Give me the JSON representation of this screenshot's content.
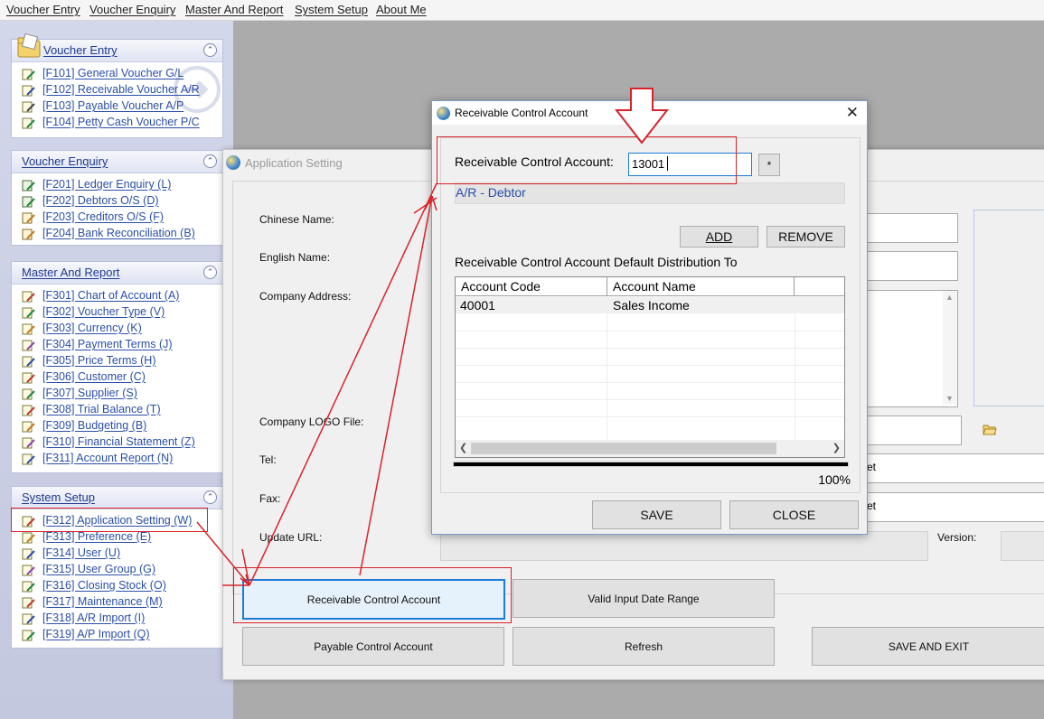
{
  "menubar": {
    "items": [
      "Voucher Entry",
      "Voucher Enquiry",
      "Master And Report",
      "System Setup",
      "About Me"
    ]
  },
  "sidebar": {
    "voucher_entry": {
      "title": "Voucher Entry",
      "items": [
        "[F101] General Voucher G/L",
        "[F102] Receivable Voucher A/R",
        "[F103] Payable Voucher A/P",
        "[F104] Petty Cash Voucher P/C"
      ]
    },
    "voucher_enquiry": {
      "title": "Voucher Enquiry",
      "items": [
        "[F201] Ledger Enquiry (L)",
        "[F202] Debtors O/S (D)",
        "[F203] Creditors O/S (F)",
        "[F204] Bank Reconciliation (B)"
      ]
    },
    "master_report": {
      "title": "Master And Report",
      "items": [
        "[F301] Chart of Account (A)",
        "[F302] Voucher Type (V)",
        "[F303] Currency (K)",
        "[F304] Payment Terms (J)",
        "[F305] Price Terms (H)",
        "[F306] Customer (C)",
        "[F307] Supplier (S)",
        "[F308] Trial Balance (T)",
        "[F309] Budgeting (B)",
        "[F310] Financial Statement (Z)",
        "[F311] Account Report (N)"
      ]
    },
    "system_setup": {
      "title": "System Setup",
      "items": [
        "[F312] Application Setting (W)",
        "[F313] Preference (E)",
        "[F314] User (U)",
        "[F315] User Group (G)",
        "[F316] Closing Stock (O)",
        "[F317] Maintenance (M)",
        "[F318] A/R Import (I)",
        "[F319] A/P Import (Q)"
      ]
    }
  },
  "app_setting": {
    "title": "Application Setting",
    "labels": {
      "chinese_name": "Chinese Name:",
      "english_name": "English Name:",
      "company_address": "Company Address:",
      "logo_file": "Company LOGO File:",
      "tel": "Tel:",
      "fax": "Fax:",
      "update_url": "Update URL:",
      "version": "Version:"
    },
    "tel_partial": "et",
    "fax_partial": "et",
    "buttons": {
      "receivable_control": "Receivable Control Account",
      "valid_date_range": "Valid Input Date Range",
      "payable_control": "Payable Control Account",
      "refresh": "Refresh",
      "save_exit": "SAVE AND EXIT"
    }
  },
  "dialog": {
    "title": "Receivable Control Account",
    "account_label": "Receivable Control Account:",
    "account_value": "13001",
    "star_button": "*",
    "account_desc": "A/R - Debtor",
    "add_button": "ADD",
    "remove_button": "REMOVE",
    "dist_label": "Receivable Control Account Default Distribution To",
    "grid": {
      "columns": [
        "Account Code",
        "Account Name"
      ],
      "rows": [
        [
          "40001",
          "Sales Income"
        ]
      ]
    },
    "progress_text": "100%",
    "progress": 1.0,
    "save_button": "SAVE",
    "close_button": "CLOSE"
  },
  "colors": {
    "annotation_red": "#d8232a",
    "sidebar_link": "#2a4fa8",
    "focus_blue": "#1e7bd6"
  }
}
